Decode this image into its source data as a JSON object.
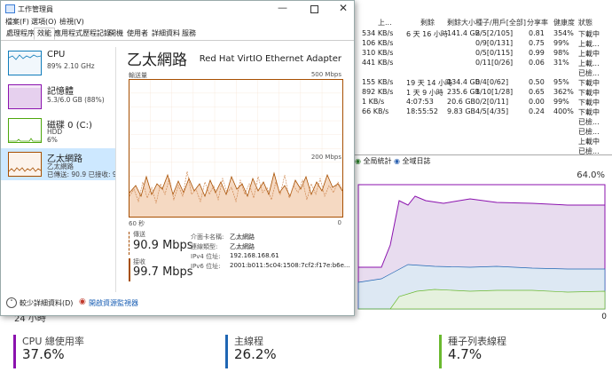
{
  "colors": {
    "cpu": "#117dbb",
    "memory": "#8b12ae",
    "disk": "#4da60c",
    "ethernet": "#a74f01",
    "send_line": "#a74f01",
    "recv_line": "#a74f01",
    "graph_bg_tint": "#fcf3eb"
  },
  "taskmanager": {
    "title": "工作管理員",
    "menu": [
      "檔案(F)",
      "選項(O)",
      "檢視(V)"
    ],
    "tabs": [
      "處理程序",
      "效能",
      "應用程式歷程記錄",
      "開機",
      "使用者",
      "詳細資料",
      "服務"
    ],
    "active_tab": "效能",
    "sidebar": [
      {
        "name": "CPU",
        "line1": "89%  2.10 GHz",
        "line2": ""
      },
      {
        "name": "記憶體",
        "line1": "5.3/6.0 GB (88%)",
        "line2": ""
      },
      {
        "name": "磁碟 0 (C:)",
        "line1": "HDD",
        "line2": "6%"
      },
      {
        "name": "乙太網路",
        "line1": "乙太網路",
        "line2": "已傳送: 90.9  已接收: 99"
      }
    ],
    "detail": {
      "title": "乙太網路",
      "adapter": "Red Hat VirtIO Ethernet Adapter",
      "throughput_label": "輸送量",
      "max_label": "500 Mbps",
      "mid_label": "200 Mbps",
      "time_label": "60 秒",
      "zero_label": "0",
      "send_label": "傳送",
      "send_value": "90.9 Mbps",
      "recv_label": "接收",
      "recv_value": "99.7 Mbps",
      "props": [
        {
          "k": "介面卡名稱:",
          "v": "乙太網路"
        },
        {
          "k": "連線類型:",
          "v": "乙太網路"
        },
        {
          "k": "IPv4 位址:",
          "v": "192.168.168.61"
        },
        {
          "k": "IPv6 位址:",
          "v": "2001:b011:5c04:1508:7cf2:f17e:b6e..."
        }
      ]
    },
    "footer": {
      "less": "較少詳細資料(D)",
      "monitor": "開啟資源監視器"
    }
  },
  "torrent": {
    "headers": [
      "上...",
      "剩餘",
      "剩餘大小",
      "種子/用戶[全部]",
      "分享率",
      "健康度",
      "狀態"
    ],
    "rows": [
      {
        "speed": "534 KB/s",
        "remain": "6 天 16 小時",
        "size": "141.4 GB",
        "peers": "2/5[2/105]",
        "ratio": "0.81",
        "health": "354%",
        "status": "下載中"
      },
      {
        "speed": "106 KB/s",
        "remain": "",
        "size": "",
        "peers": "0/9[0/131]",
        "ratio": "0.75",
        "health": "99%",
        "status": "上載..."
      },
      {
        "speed": "310 KB/s",
        "remain": "",
        "size": "",
        "peers": "0/5[0/115]",
        "ratio": "0.99",
        "health": "98%",
        "status": "上載中"
      },
      {
        "speed": "441 KB/s",
        "remain": "",
        "size": "",
        "peers": "0/11[0/26]",
        "ratio": "0.06",
        "health": "31%",
        "status": "上載..."
      },
      {
        "speed": "",
        "remain": "",
        "size": "",
        "peers": "",
        "ratio": "",
        "health": "",
        "status": "已檢..."
      },
      {
        "speed": "155 KB/s",
        "remain": "19 天 14 小時",
        "size": "134.4 GB",
        "peers": "0/4[0/62]",
        "ratio": "0.50",
        "health": "95%",
        "status": "下載中"
      },
      {
        "speed": "892 KB/s",
        "remain": "1 天 9 小時",
        "size": "235.6 GB",
        "peers": "1/10[1/28]",
        "ratio": "0.65",
        "health": "362%",
        "status": "下載中"
      },
      {
        "speed": "1 KB/s",
        "remain": "4:07:53",
        "size": "20.6 GB",
        "peers": "0/2[0/11]",
        "ratio": "0.00",
        "health": "99%",
        "status": "下載中"
      },
      {
        "speed": "66 KB/s",
        "remain": "18:55:52",
        "size": "9.83 GB",
        "peers": "4/5[4/35]",
        "ratio": "0.24",
        "health": "400%",
        "status": "下載中"
      },
      {
        "speed": "",
        "remain": "",
        "size": "",
        "peers": "",
        "ratio": "",
        "health": "",
        "status": "已檢..."
      },
      {
        "speed": "",
        "remain": "",
        "size": "",
        "peers": "",
        "ratio": "",
        "health": "",
        "status": "已檢..."
      },
      {
        "speed": "",
        "remain": "",
        "size": "",
        "peers": "",
        "ratio": "",
        "health": "",
        "status": "上載中"
      },
      {
        "speed": "",
        "remain": "",
        "size": "",
        "peers": "",
        "ratio": "",
        "health": "",
        "status": "已檢..."
      }
    ],
    "toolbar": {
      "global_stats": "全局統計",
      "global_log": "全域日誌"
    },
    "graph_max": "64.0%",
    "graph_zero": "0",
    "graph_time": "24 小時",
    "stats": [
      {
        "label": "CPU 總使用率",
        "value": "37.6%",
        "color": "#8b12ae"
      },
      {
        "label": "主線程",
        "value": "26.2%",
        "color": "#1f66b3"
      },
      {
        "label": "種子列表線程",
        "value": "4.7%",
        "color": "#6ab92f"
      }
    ]
  }
}
